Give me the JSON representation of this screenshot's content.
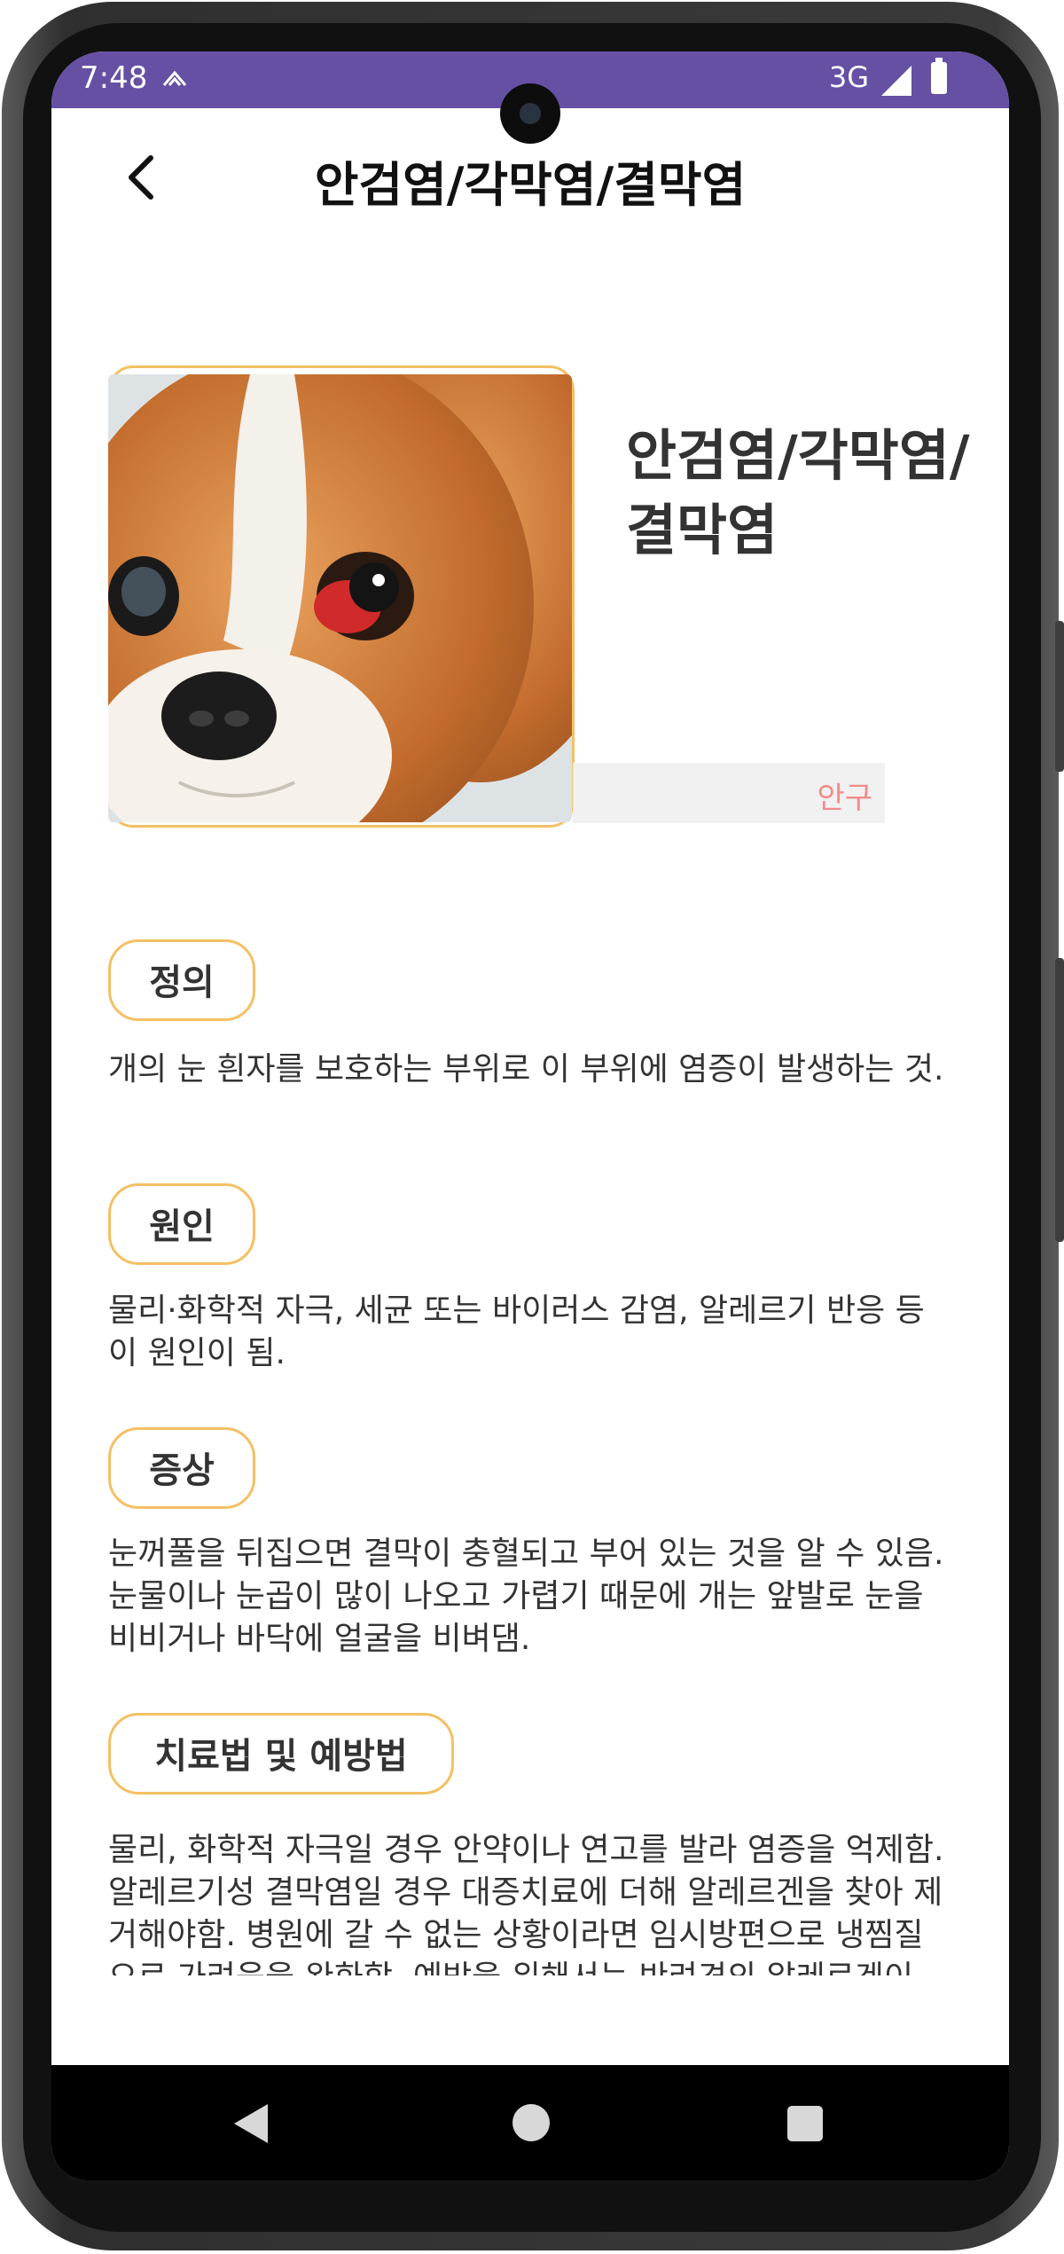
{
  "status_bar": {
    "time": "7:48",
    "network": "3G",
    "bg_color": "#6650a4"
  },
  "app_bar": {
    "back_icon": "chevron-left-icon",
    "title": "안검염/각막염/결막염"
  },
  "disease": {
    "name": "안검염/각막염/결막염",
    "category": "안구",
    "image_alt": "dog-with-red-eye"
  },
  "sections": [
    {
      "label": "정의",
      "text": "개의 눈 흰자를 보호하는 부위로 이 부위에 염증이 발생하는 것."
    },
    {
      "label": "원인",
      "text": "물리·화학적 자극,  세균 또는 바이러스 감염,  알레르기 반응 등이 원인이 됨."
    },
    {
      "label": "증상",
      "text": "눈꺼풀을 뒤집으면 결막이 충혈되고 부어 있는 것을 알 수 있음. 눈물이나 눈곱이 많이 나오고 가렵기 때문에 개는 앞발로 눈을 비비거나 바닥에 얼굴을 비벼댐."
    },
    {
      "label": "치료법 및 예방법",
      "text": "물리, 화학적 자극일 경우 안약이나 연고를 발라 염증을 억제함. 알레르기성 결막염일 경우 대증치료에 더해 알레르겐을 찾아 제거해야함. 병원에 갈 수 없는 상황이라면 임시방편으로 냉찜질으로 가려움을 완화함. 예방을 위해서는 반려견의 알레르겐이 무엇인지를 미리 알아두고, 가급적 정해진 식사만 하도록 해야함."
    }
  ],
  "nav_bar": {
    "back_icon": "nav-back-icon",
    "home_icon": "nav-home-icon",
    "recent_icon": "nav-recents-icon"
  },
  "colors": {
    "accent_border": "#f4c064",
    "category_text": "#f28b8b"
  }
}
